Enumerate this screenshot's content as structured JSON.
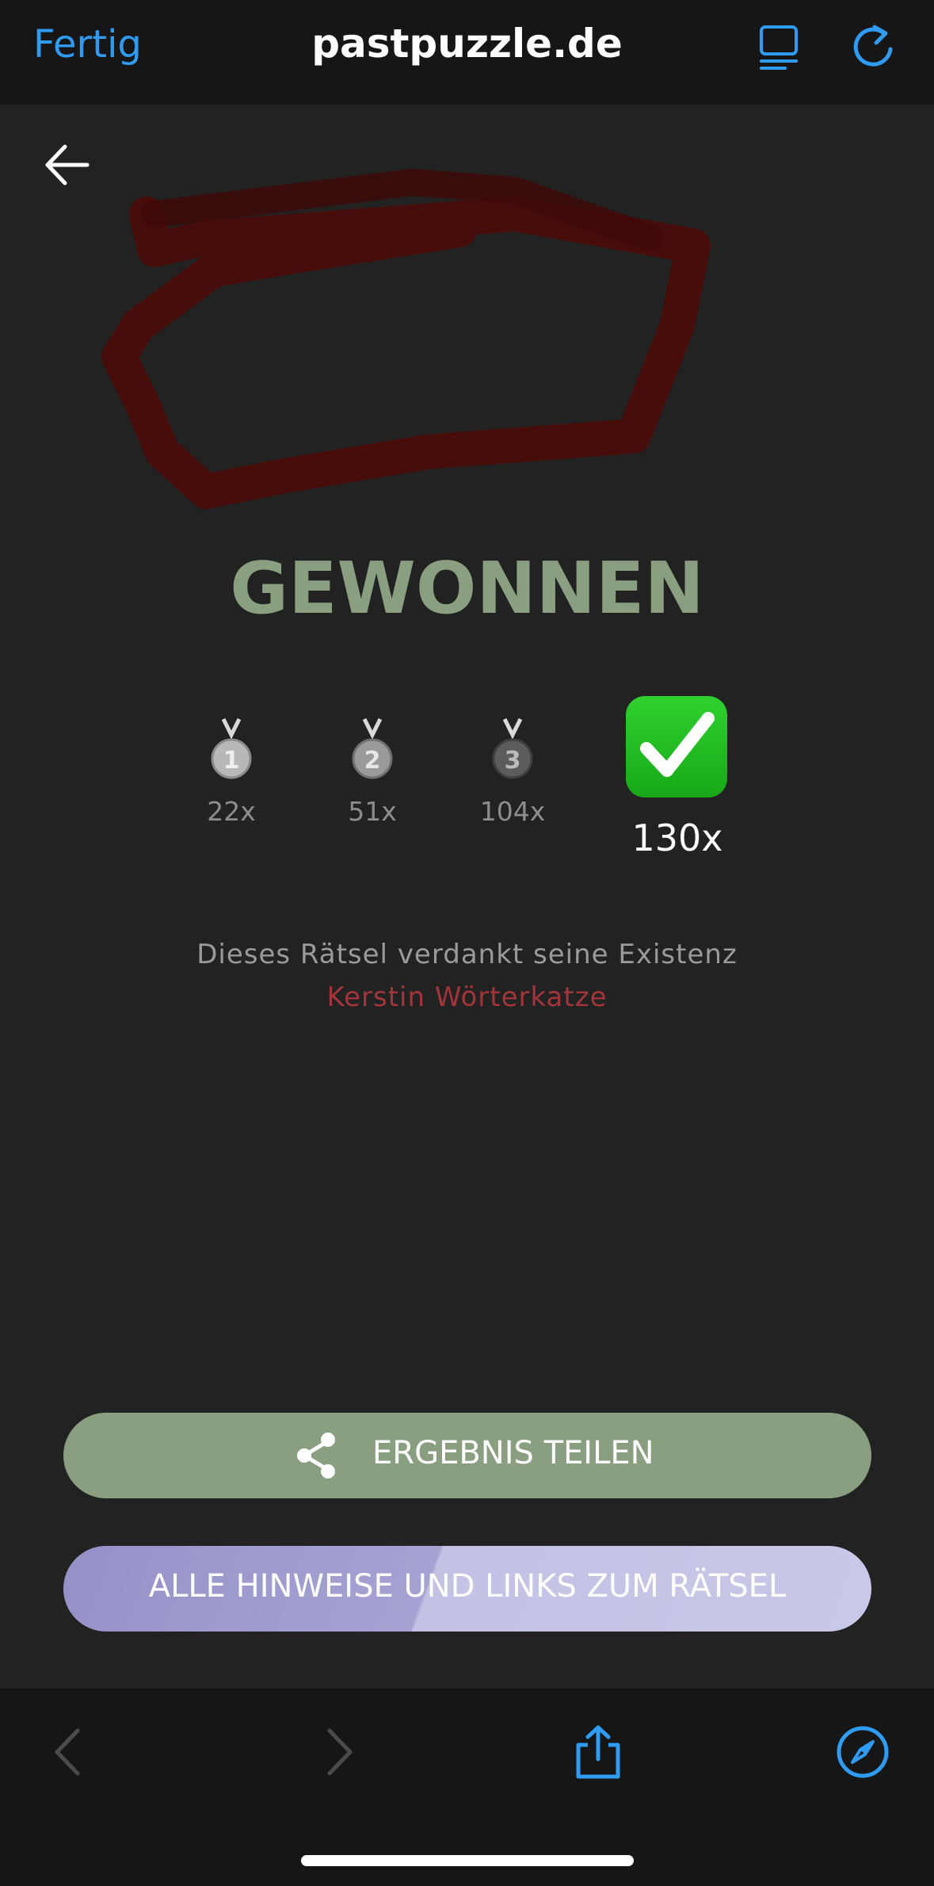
{
  "browser": {
    "done_label": "Fertig",
    "domain": "pastpuzzle.de",
    "accent": "#2f9bf2"
  },
  "result": {
    "title": "GEWONNEN",
    "stats": [
      {
        "icon": "medal-1-icon",
        "count": "22x"
      },
      {
        "icon": "medal-2-icon",
        "count": "51x"
      },
      {
        "icon": "medal-3-icon",
        "count": "104x"
      },
      {
        "icon": "check-mark-icon",
        "count": "130x"
      }
    ],
    "credit_text": "Dieses Rätsel verdankt seine Existenz",
    "author": "Kerstin Wörterkatze"
  },
  "actions": {
    "share_label": "ERGEBNIS TEILEN",
    "hints_label": "ALLE HINWEISE UND LINKS ZUM RÄTSEL"
  },
  "colors": {
    "success_green": "#8a9e80",
    "author_red": "#a3343a",
    "hints_purple": "#9591c8"
  }
}
